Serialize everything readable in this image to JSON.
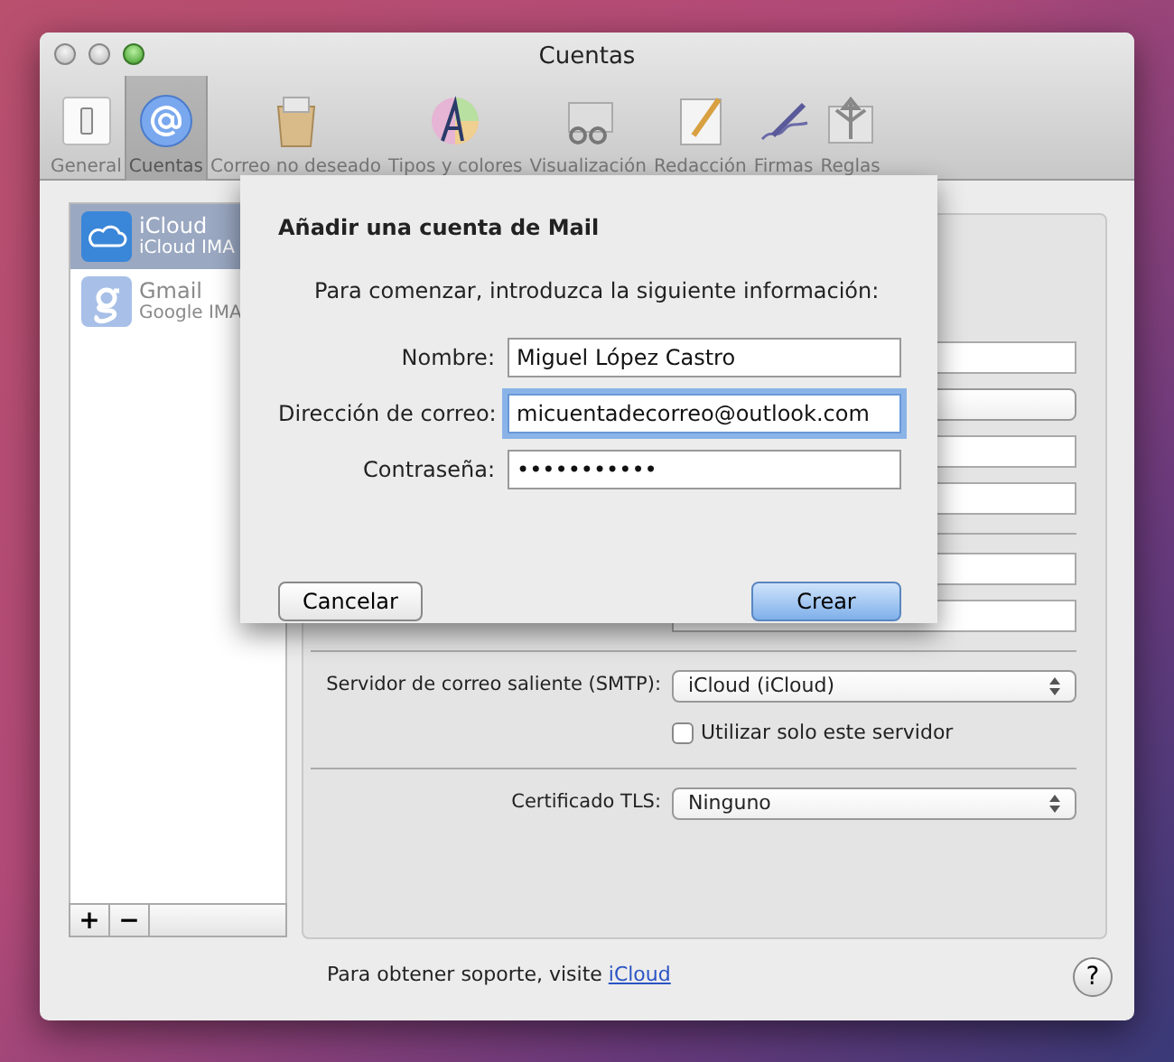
{
  "window": {
    "title": "Cuentas"
  },
  "toolbar": [
    {
      "label": "General",
      "selected": false
    },
    {
      "label": "Cuentas",
      "selected": true
    },
    {
      "label": "Correo no deseado",
      "selected": false
    },
    {
      "label": "Tipos y colores",
      "selected": false
    },
    {
      "label": "Visualización",
      "selected": false
    },
    {
      "label": "Redacción",
      "selected": false
    },
    {
      "label": "Firmas",
      "selected": false
    },
    {
      "label": "Reglas",
      "selected": false
    }
  ],
  "accounts": [
    {
      "kind": "icloud",
      "name": "iCloud",
      "type": "iCloud IMA",
      "selected": true
    },
    {
      "kind": "gmail",
      "name": "Gmail",
      "type": "Google IMA",
      "selected": false
    }
  ],
  "list_buttons": [
    "+",
    "−"
  ],
  "smtp": {
    "label": "Servidor de correo saliente (SMTP):",
    "value": "iCloud (iCloud)"
  },
  "only_this_server": {
    "label": "Utilizar solo este servidor",
    "checked": false
  },
  "tls": {
    "label": "Certificado TLS:",
    "value": "Ninguno"
  },
  "footer": {
    "text": "Para obtener soporte, visite",
    "link": "iCloud"
  },
  "help_button": "?",
  "sheet": {
    "title": "Añadir una cuenta de Mail",
    "intro": "Para comenzar, introduzca la siguiente información:",
    "fields": [
      {
        "label": "Nombre:",
        "value": "Miguel López Castro",
        "focused": false
      },
      {
        "label": "Dirección de correo:",
        "value": "micuentadecorreo@outlook.com",
        "focused": true
      },
      {
        "label": "Contraseña:",
        "value": "•••••••••••",
        "focused": false
      }
    ],
    "buttons": [
      {
        "label": "Cancelar",
        "default": false
      },
      {
        "label": "Crear",
        "default": true
      }
    ]
  }
}
